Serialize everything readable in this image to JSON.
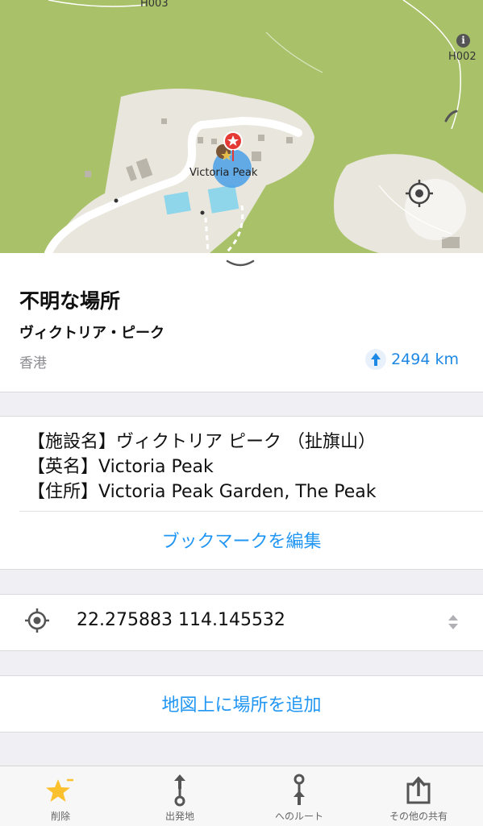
{
  "map": {
    "labels": {
      "h003": "H003",
      "h002": "H002",
      "pin": "Victoria Peak"
    },
    "info_icon": "i",
    "colors": {
      "grass": "#a9c26a",
      "land": "#e9e6dd",
      "road": "#ffffff",
      "water": "#8fd6ea",
      "accuracy": "#4a9fe8"
    }
  },
  "place": {
    "title": "不明な場所",
    "subtitle": "ヴィクトリア・ピーク",
    "region": "香港",
    "distance": "2494 km"
  },
  "description": {
    "lines": [
      "【施設名】ヴィクトリア ピーク （扯旗山）",
      "【英名】Victoria Peak",
      "【住所】Victoria Peak Garden, The Peak"
    ],
    "edit_label": "ブックマークを編集"
  },
  "coordinates": {
    "value": "22.275883 114.145532"
  },
  "add_place_label": "地図上に場所を追加",
  "tabbar": {
    "items": [
      {
        "label": "削除",
        "icon": "star-delete-icon"
      },
      {
        "label": "出発地",
        "icon": "route-start-icon"
      },
      {
        "label": "へのルート",
        "icon": "route-to-icon"
      },
      {
        "label": "その他の共有",
        "icon": "share-icon"
      }
    ]
  },
  "colors": {
    "accent": "#2196f3",
    "star": "#fbc02d",
    "marker": "#e53935"
  }
}
